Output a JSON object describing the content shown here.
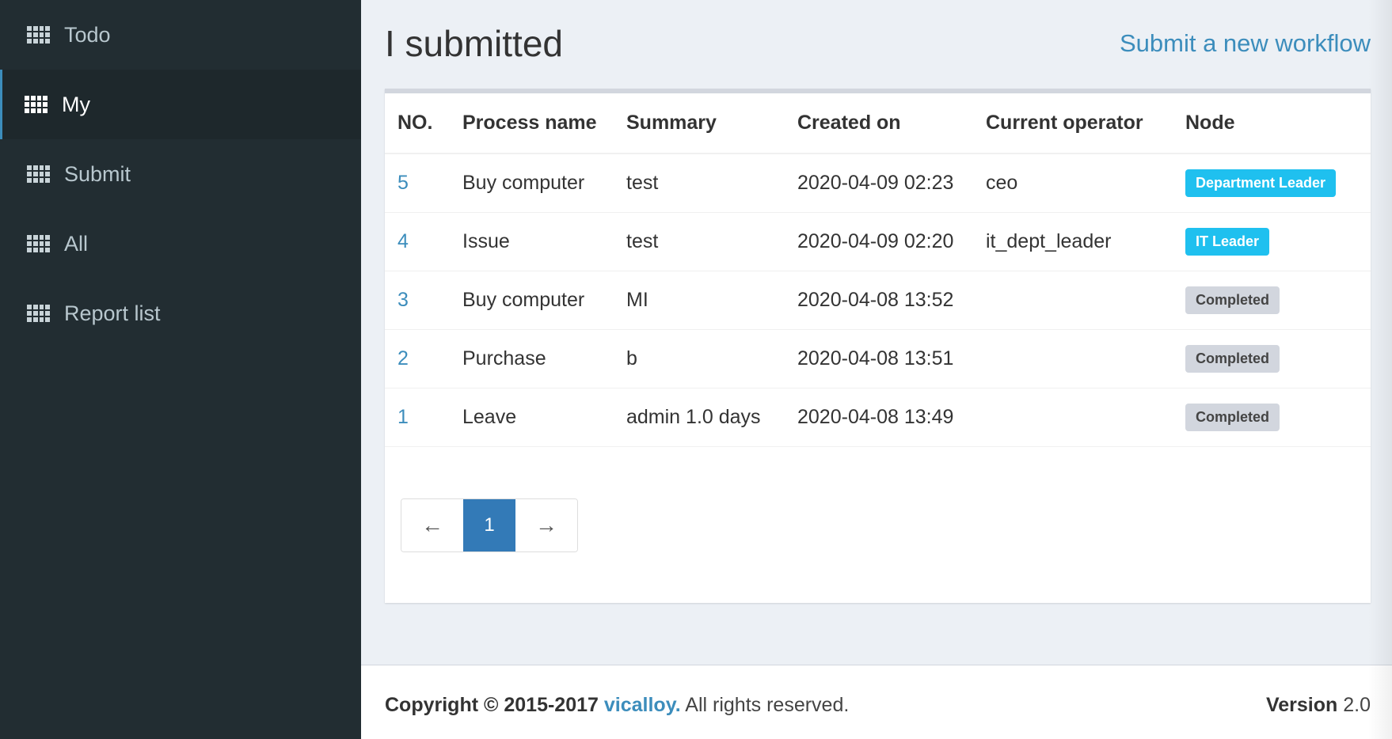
{
  "sidebar": {
    "items": [
      {
        "label": "Todo",
        "icon": "grid-icon"
      },
      {
        "label": "My",
        "icon": "grid-icon",
        "active": true
      },
      {
        "label": "Submit",
        "icon": "grid-icon"
      },
      {
        "label": "All",
        "icon": "grid-icon"
      },
      {
        "label": "Report list",
        "icon": "grid-icon"
      }
    ]
  },
  "header": {
    "title": "I submitted",
    "new_workflow_link": "Submit a new workflow"
  },
  "table": {
    "columns": [
      "NO.",
      "Process name",
      "Summary",
      "Created on",
      "Current operator",
      "Node"
    ],
    "rows": [
      {
        "no": "5",
        "process": "Buy computer",
        "summary": "test",
        "created": "2020-04-09 02:23",
        "operator": "ceo",
        "node": "Department Leader",
        "node_style": "info"
      },
      {
        "no": "4",
        "process": "Issue",
        "summary": "test",
        "created": "2020-04-09 02:20",
        "operator": "it_dept_leader",
        "node": "IT Leader",
        "node_style": "info"
      },
      {
        "no": "3",
        "process": "Buy computer",
        "summary": "MI",
        "created": "2020-04-08 13:52",
        "operator": "",
        "node": "Completed",
        "node_style": "done"
      },
      {
        "no": "2",
        "process": "Purchase",
        "summary": "b",
        "created": "2020-04-08 13:51",
        "operator": "",
        "node": "Completed",
        "node_style": "done"
      },
      {
        "no": "1",
        "process": "Leave",
        "summary": "admin 1.0 days",
        "created": "2020-04-08 13:49",
        "operator": "",
        "node": "Completed",
        "node_style": "done"
      }
    ]
  },
  "pagination": {
    "prev": "←",
    "current": "1",
    "next": "→"
  },
  "footer": {
    "copyright_prefix": "Copyright © 2015-2017",
    "brand": "vicalloy.",
    "rights": "All rights reserved.",
    "version_label": "Version",
    "version_value": "2.0"
  },
  "colors": {
    "sidebar_bg": "#222d32",
    "link": "#3c8dbc",
    "badge_info": "#1fc0ef",
    "badge_done": "#d2d6de",
    "pager_active": "#337ab7"
  }
}
